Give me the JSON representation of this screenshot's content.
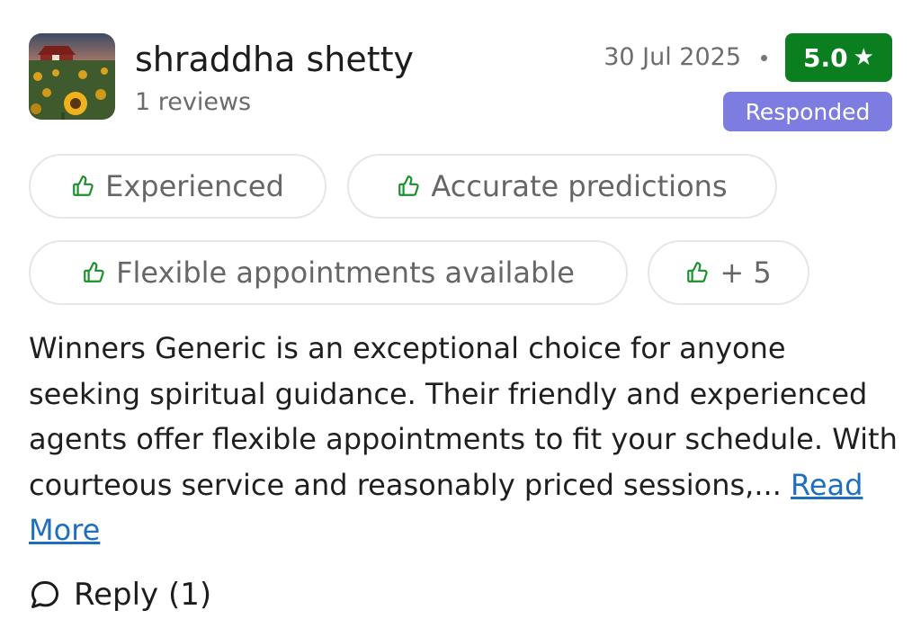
{
  "review": {
    "reviewer_name": "shraddha shetty",
    "review_count": "1 reviews",
    "date": "30 Jul 2025",
    "rating": "5.0",
    "rating_icon": "star-icon",
    "status_badge": "Responded",
    "colors": {
      "rating_badge": "#0b7f1f",
      "responded_badge": "#7d7ce0",
      "link": "#1f6fbf",
      "tag_border": "#e6e6e6",
      "tag_icon": "#1a8f2e"
    },
    "tags": [
      {
        "label": "Experienced",
        "icon": "thumbs-up-icon"
      },
      {
        "label": "Accurate predictions",
        "icon": "thumbs-up-icon"
      },
      {
        "label": "Flexible appointments available",
        "icon": "thumbs-up-icon"
      },
      {
        "label": "+ 5",
        "icon": "thumbs-up-icon"
      }
    ],
    "text": "Winners Generic is an exceptional choice for anyone seeking spiritual guidance. Their friendly and experienced agents offer flexible appointments to fit your schedule. With courteous service and reasonably priced sessions,... ",
    "read_more": "Read More",
    "reply_label": "Reply (1)",
    "reply_icon": "chat-bubble-icon"
  }
}
